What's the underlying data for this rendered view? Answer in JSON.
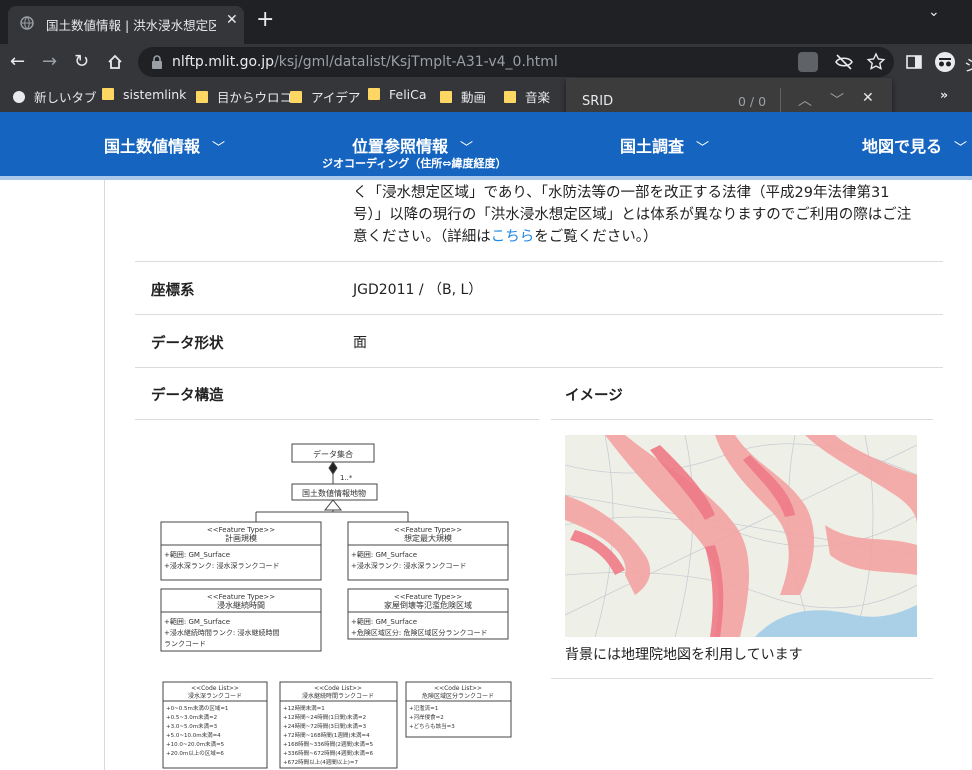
{
  "browser": {
    "tab_title": "国土数値情報 | 洪水浸水想定区域",
    "url_host": "nlftp.mlit.go.jp",
    "url_path": "/ksj/gml/datalist/KsjTmplt-A31-v4_0.html",
    "bookmarks": [
      "新しいタブ",
      "sistemlink",
      "目からウロコ",
      "アイデア",
      "FeliCa",
      "動画",
      "音楽"
    ],
    "find": {
      "query": "SRID",
      "count": "0 / 0"
    }
  },
  "nav": {
    "items": [
      "国土数値情報",
      "位置参照情報",
      "国土調査",
      "地図で見る"
    ],
    "sub": "ジオコーディング（住所⇔緯度経度）"
  },
  "notice": {
    "line1": "く「浸水想定区域」であり、「水防法等の一部を改正する法律（平成29年法律第31",
    "line2": "号）」以降の現行の「洪水浸水想定区域」とは体系が異なりますのでご利用の際はご注",
    "line3_a": "意ください。（詳細は",
    "line3_link": "こちら",
    "line3_b": "をご覧ください。）"
  },
  "table": {
    "crs_label": "座標系",
    "crs_value": "JGD2011 / （B, L）",
    "shape_label": "データ形状",
    "shape_value": "面",
    "structure_label": "データ構造",
    "image_label": "イメージ",
    "image_caption": "背景には地理院地図を利用しています"
  },
  "uml": {
    "root": "データ集合",
    "multiplicity": "1..*",
    "main": "国土数値情報地物",
    "stereotype": "<<Feature Type>>",
    "f1_name": "計画規模",
    "f1_attr1": "+範囲: GM_Surface",
    "f1_attr2": "+浸水深ランク: 浸水深ランクコード",
    "f2_name": "想定最大規模",
    "f2_attr1": "+範囲: GM_Surface",
    "f2_attr2": "+浸水深ランク: 浸水深ランクコード",
    "f3_name": "浸水継続時間",
    "f3_attr1": "+範囲: GM_Surface",
    "f3_attr2": "+浸水継続時間ランク: 浸水継続時間",
    "f3_attr3": "ランクコード",
    "f4_name": "家屋倒壊等氾濫危険区域",
    "f4_attr1": "+範囲: GM_Surface",
    "f4_attr2": "+危険区域区分: 危険区域区分ランクコード",
    "cl_stereotype": "<<Code List>>",
    "cl1_name": "浸水深ランクコード",
    "cl1_items": [
      "+0~0.5m未満の区域=1",
      "+0.5~3.0m未満=2",
      "+3.0~5.0m未満=3",
      "+5.0~10.0m未満=4",
      "+10.0~20.0m未満=5",
      "+20.0m以上の区域=6"
    ],
    "cl2_name": "浸水継続時間ランクコード",
    "cl2_items": [
      "+12時間未満=1",
      "+12時間~24時間(1日間)未満=2",
      "+24時間~72時間(3日間)未満=3",
      "+72時間~168時間(1週間)未満=4",
      "+168時間~336時間(2週間)未満=5",
      "+336時間~672時間(4週間)未満=6",
      "+672時間以上(4週間以上)=7"
    ],
    "cl3_name": "危険区域区分ランクコード",
    "cl3_items": [
      "+氾濫流=1",
      "+河岸侵食=2",
      "+どちらも該当=3"
    ]
  },
  "colors": {
    "nav_bg": "#1565c0",
    "link": "#1e88e5",
    "chrome_dark": "#202124",
    "chrome": "#35363a"
  }
}
